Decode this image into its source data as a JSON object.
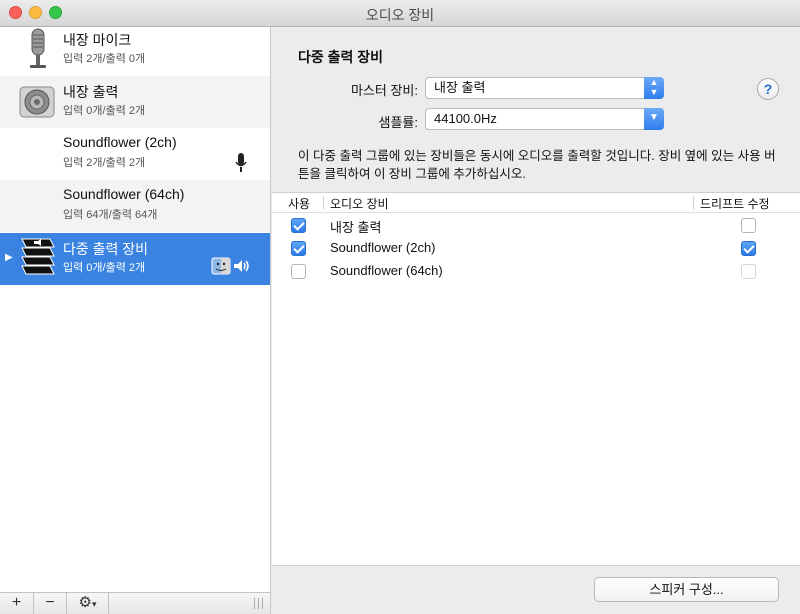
{
  "window": {
    "title": "오디오 장비"
  },
  "sidebar": {
    "devices": [
      {
        "name": "내장 마이크",
        "io": "입력 2개/출력 0개",
        "icon": "microphone-icon"
      },
      {
        "name": "내장 출력",
        "io": "입력 0개/출력 2개",
        "icon": "speaker-icon"
      },
      {
        "name": "Soundflower (2ch)",
        "io": "입력 2개/출력 2개",
        "badge": "microphone-small-icon"
      },
      {
        "name": "Soundflower (64ch)",
        "io": "입력 64개/출력 64개"
      },
      {
        "name": "다중 출력 장비",
        "io": "입력 0개/출력 2개",
        "icon": "multi-output-icon",
        "selected": true,
        "badges": [
          "finder-icon",
          "volume-icon"
        ]
      }
    ],
    "bottom": {
      "add": "+",
      "remove": "−",
      "gear": "gear-icon"
    }
  },
  "detail": {
    "heading": "다중 출력 장비",
    "master_label": "마스터 장비:",
    "master_value": "내장 출력",
    "sample_label": "샘플률:",
    "sample_value": "44100.0Hz",
    "help": "?",
    "description": "이 다중 출력 그룹에 있는 장비들은 동시에 오디오를 출력할 것입니다. 장비 옆에 있는 사용 버튼을 클릭하여 이 장비 그룹에 추가하십시오.",
    "table": {
      "headers": {
        "use": "사용",
        "device": "오디오 장비",
        "drift": "드리프트 수정"
      },
      "rows": [
        {
          "use": true,
          "device": "내장 출력",
          "drift": false,
          "drift_enabled": true
        },
        {
          "use": true,
          "device": "Soundflower (2ch)",
          "drift": true,
          "drift_enabled": true
        },
        {
          "use": false,
          "device": "Soundflower (64ch)",
          "drift": false,
          "drift_enabled": false
        }
      ]
    },
    "speaker_button": "스피커 구성..."
  }
}
